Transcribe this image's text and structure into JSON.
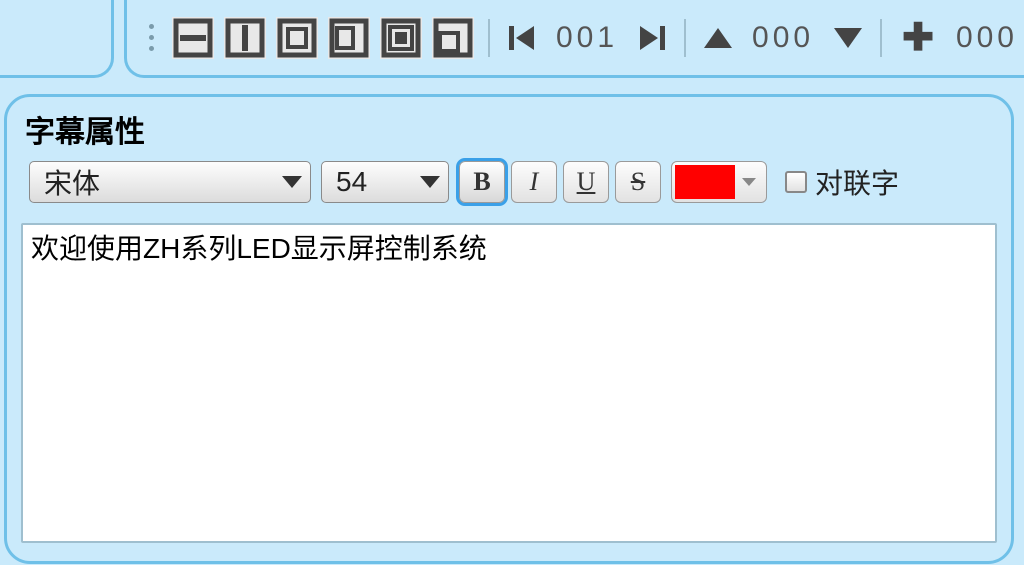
{
  "toolbar": {
    "counter1": "001",
    "counter2": "000",
    "counter3": "000"
  },
  "panel": {
    "title": "字幕属性",
    "font_name": "宋体",
    "font_size": "54",
    "bold_label": "B",
    "italic_label": "I",
    "underline_label": "U",
    "strike_label": "S",
    "color_value": "#ff0000",
    "couplet_label": "对联字",
    "text_content": "欢迎使用ZH系列LED显示屏控制系统"
  }
}
